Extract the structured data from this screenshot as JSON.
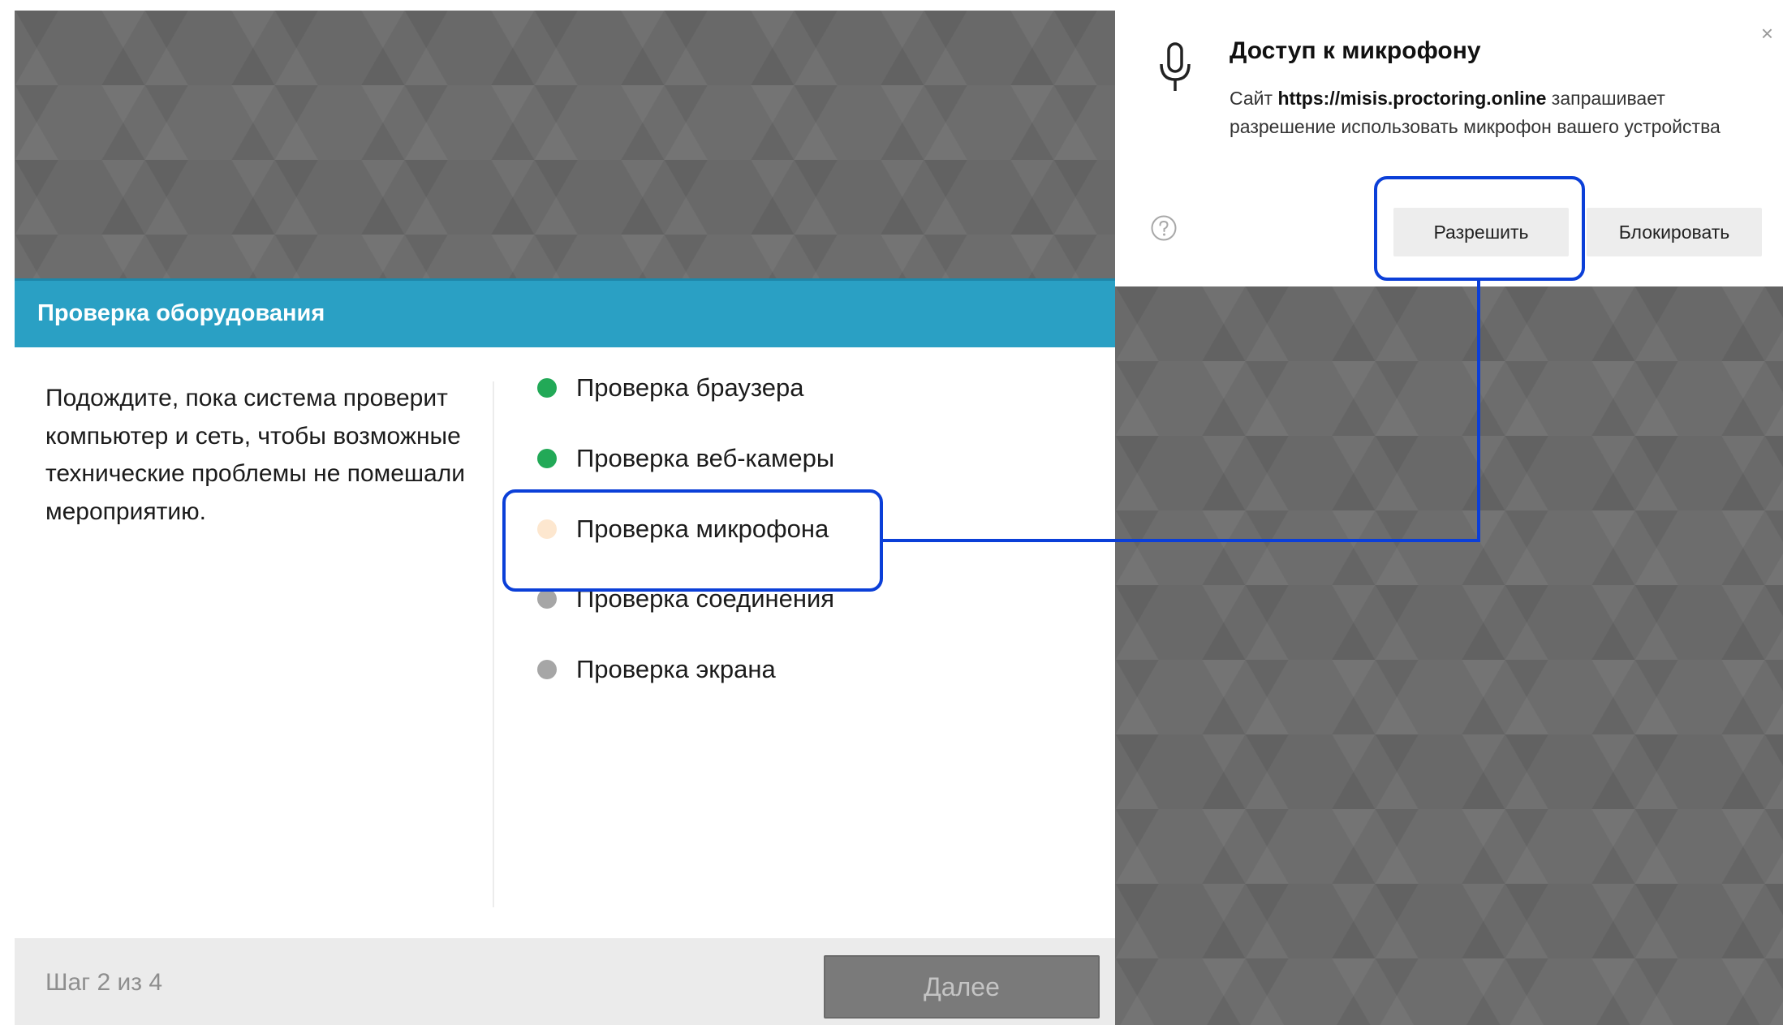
{
  "card": {
    "title": "Проверка оборудования",
    "description": "Подождите, пока система проверит компьютер и сеть, чтобы возможные технические проблемы не помешали мероприятию.",
    "checks": [
      {
        "label": "Проверка браузера",
        "status": "passed",
        "color": "#22a957"
      },
      {
        "label": "Проверка веб-камеры",
        "status": "passed",
        "color": "#22a957"
      },
      {
        "label": "Проверка микрофона",
        "status": "in-progress",
        "color": "#fde7cf"
      },
      {
        "label": "Проверка соединения",
        "status": "pending",
        "color": "#a6a6a6"
      },
      {
        "label": "Проверка экрана",
        "status": "pending",
        "color": "#a6a6a6"
      }
    ],
    "step_text": "Шаг 2 из 4",
    "next_label": "Далее"
  },
  "permission_popup": {
    "title": "Доступ к микрофону",
    "message_prefix": "Сайт",
    "site": "https://misis.proctoring.online",
    "message_suffix": "запрашивает разрешение использовать микрофон вашего устройства",
    "allow_label": "Разрешить",
    "block_label": "Блокировать",
    "close_symbol": "×"
  },
  "colors": {
    "header": "#2aa0c4",
    "highlight": "#0b3fd8",
    "background": "#696969"
  }
}
